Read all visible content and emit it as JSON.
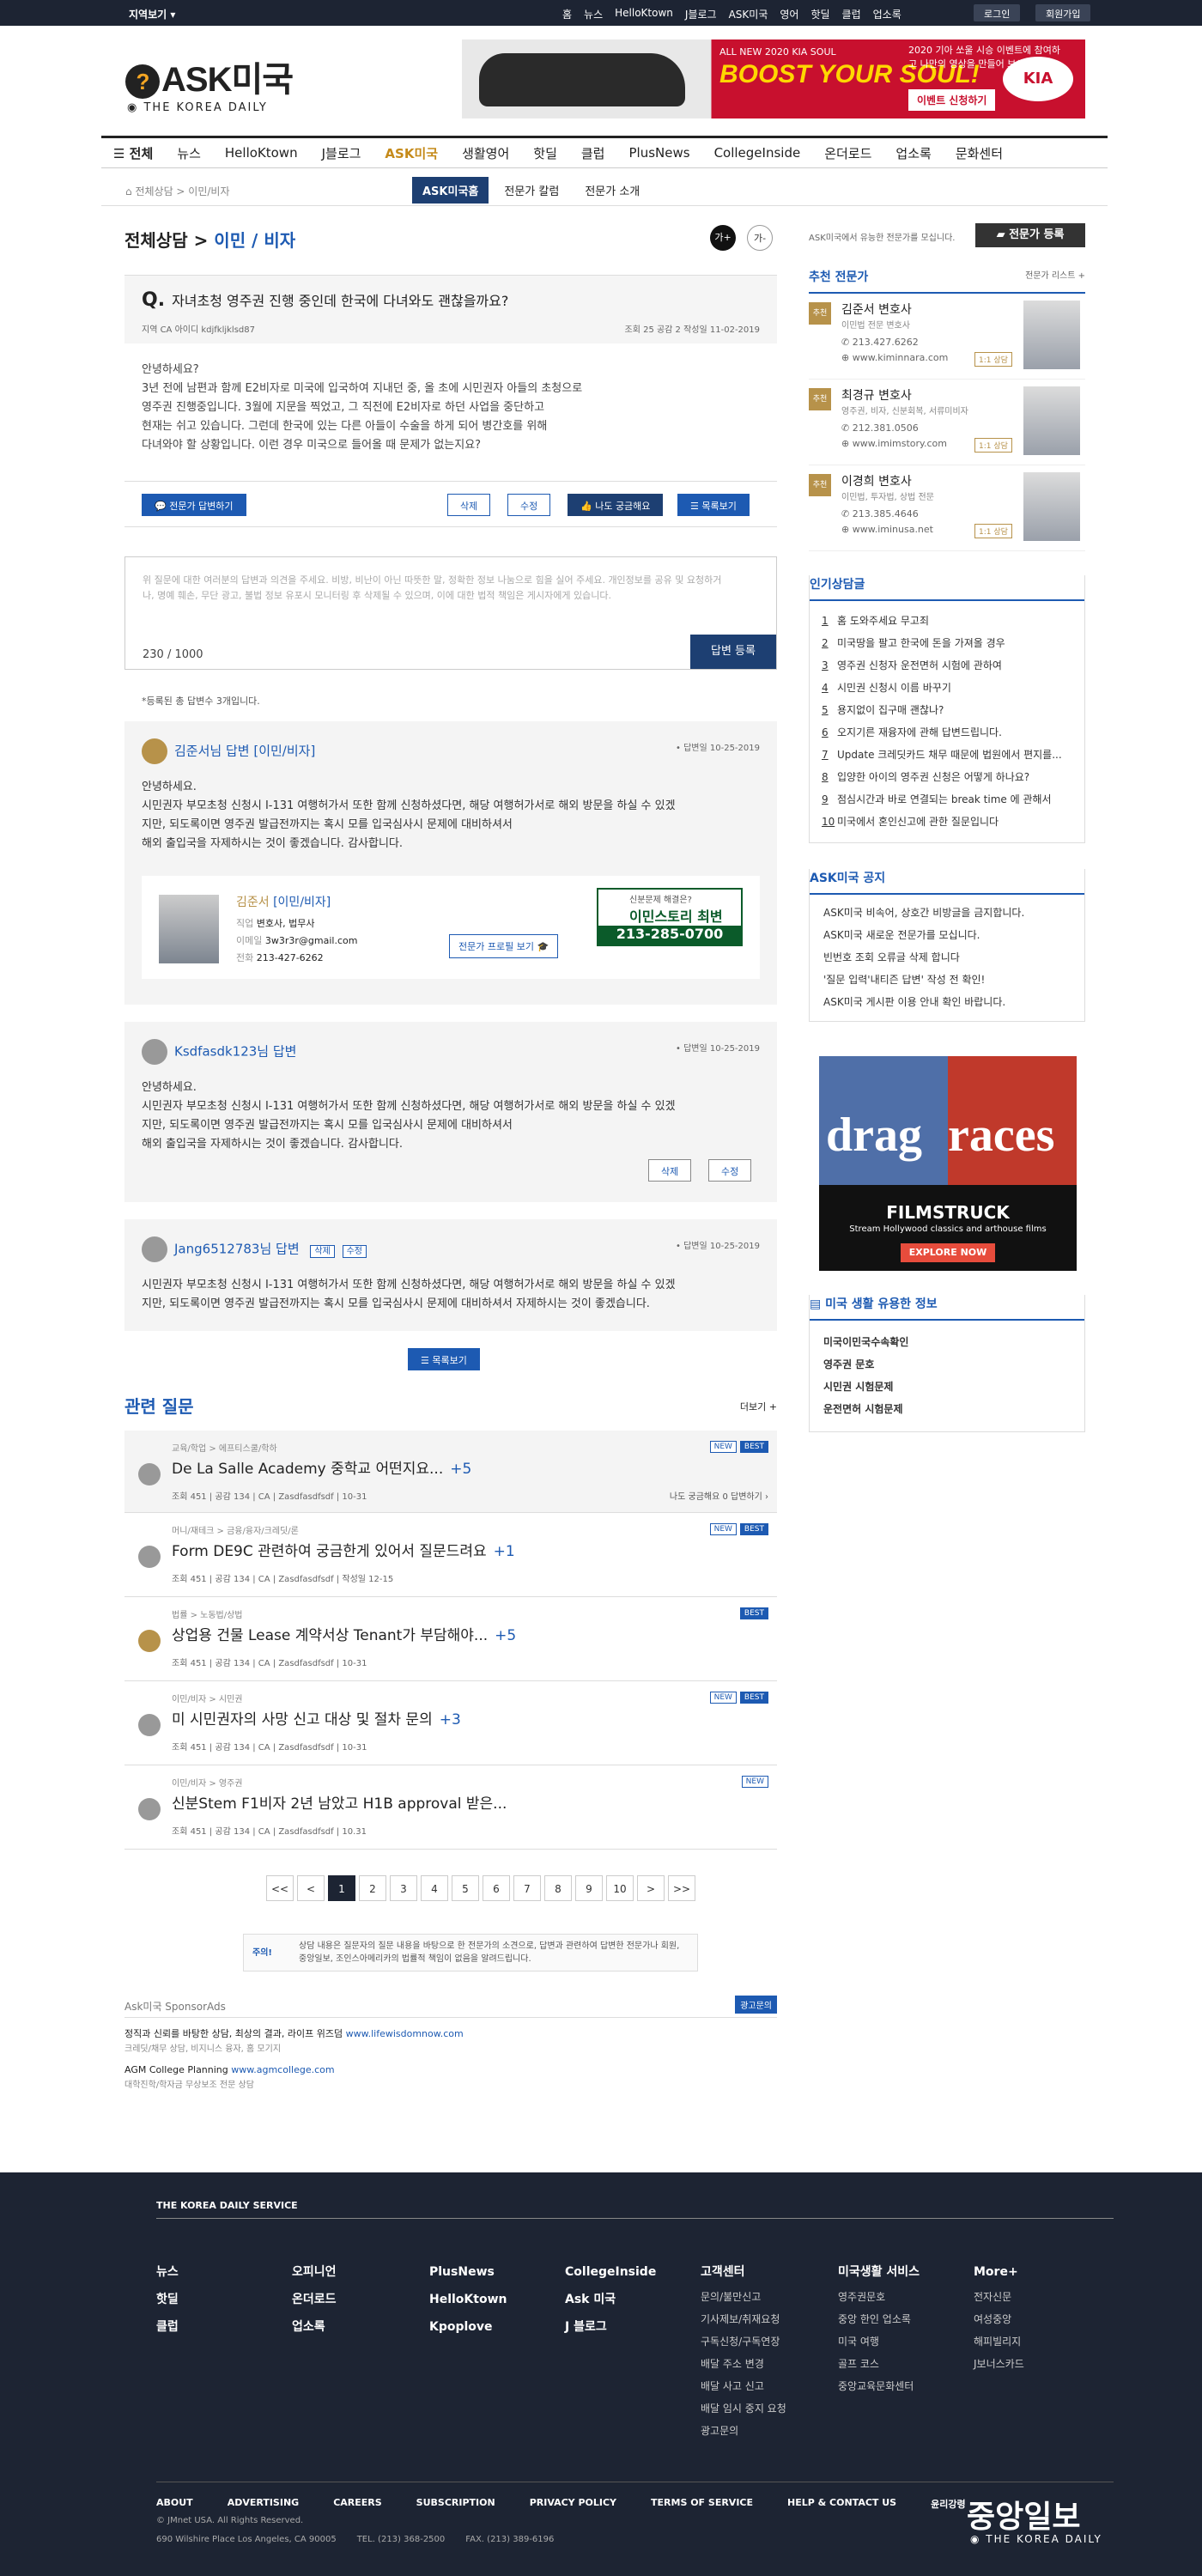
{
  "topbar": {
    "region": "지역보기",
    "links": [
      "홈",
      "뉴스",
      "HelloKtown",
      "J블로그",
      "ASK미국",
      "영어",
      "핫딜",
      "클럽",
      "업소록"
    ],
    "login": "로그인",
    "join": "회원가입"
  },
  "header": {
    "logo": "ASK미국",
    "logo_sub": "THE KOREA DAILY",
    "ad_line1": "ALL NEW 2020 KIA SOUL",
    "ad_main": "BOOST YOUR SOUL!",
    "ad_right": "2020 기아 쏘울 시승 이벤트에 참여하고 나만의 영상을 만들어 보세요!",
    "ad_cta": "이벤트 신청하기",
    "ad_brand": "KIA"
  },
  "nav": [
    "전체",
    "뉴스",
    "HelloKtown",
    "J블로그",
    "ASK미국",
    "생활영어",
    "핫딜",
    "클럽",
    "PlusNews",
    "CollegeInside",
    "온더로드",
    "업소록",
    "문화센터"
  ],
  "crumb": "전체상담  >  이민/비자",
  "tabs": [
    "ASK미국홈",
    "전문가 칼럼",
    "전문가 소개"
  ],
  "page": {
    "title": "전체상담",
    "title_sub": "이민 / 비자",
    "font_big": "가+",
    "font_small": "가-"
  },
  "question": {
    "q": "Q.",
    "title": "자녀초청 영주권 진행 중인데 한국에 다녀와도 괜찮을까요?",
    "meta": "지역 CA    아이디 kdjfkljklsd87",
    "meta2": "조회 25    공감 2    작성일 11-02-2019",
    "body": [
      "안녕하세요?",
      "3년 전에 남편과 함께 E2비자로 미국에 입국하여 지내던 중, 올 초에 시민권자 아들의 초청으로",
      "영주권 진행중입니다. 3월에 지문을 찍었고, 그 직전에 E2비자로 하던 사업을 중단하고",
      "현재는 쉬고 있습니다. 그런데 한국에 있는 다른 아들이 수술을 하게 되어 병간호를 위해",
      "다녀와야 할 상황입니다. 이런 경우 미국으로 들어올 때 문제가 없는지요?"
    ]
  },
  "buttons": {
    "expert_answer": "전문가 답변하기",
    "delete": "삭제",
    "edit": "수정",
    "curious": "나도 궁금해요",
    "list": "목록보기"
  },
  "comment": {
    "placeholder": "위 질문에 대한 여러분의 답변과 의견을 주세요. 비방, 비난이 아닌 따뜻한 말, 정확한 정보 나눔으로 힘을 실어 주세요. 개인정보를 공유 및 요청하거나, 명예 훼손, 무단 광고, 불법 정보 유포시 모니터링 후 삭제될 수 있으며, 이에 대한 법적 책임은 게시자에게 있습니다.",
    "count": "230 / 1000",
    "submit": "답변 등록"
  },
  "answer_count": "*등록된 총 답변수 3개입니다.",
  "answers": [
    {
      "name": "김준서님 답변",
      "cat": "[이민/비자]",
      "date": "• 답변일 10-25-2019",
      "body": [
        "안녕하세요.",
        "시민권자 부모초청 신청시 I-131 여행허가서 또한 함께 신청하셨다면, 해당 여행허가서로 해외 방문을 하실 수 있겠",
        "지만, 되도록이면 영주권 발급전까지는 혹시 모를 입국심사시 문제에 대비하셔서",
        "해외 출입국을 자제하시는 것이 좋겠습니다. 감사합니다."
      ]
    },
    {
      "name": "Ksdfasdk123님 답변",
      "date": "• 답변일 10-25-2019",
      "body": [
        "안녕하세요.",
        "시민권자 부모초청 신청시 I-131 여행허가서 또한 함께 신청하셨다면, 해당 여행허가서로 해외 방문을 하실 수 있겠",
        "지만, 되도록이면 영주권 발급전까지는 혹시 모를 입국심사시 문제에 대비하셔서",
        "해외 출입국을 자제하시는 것이 좋겠습니다. 감사합니다."
      ]
    },
    {
      "name": "Jang6512783님 답변",
      "date": "• 답변일 10-25-2019",
      "body": [
        "시민권자 부모초청 신청시 I-131 여행허가서 또한 함께 신청하셨다면, 해당 여행허가서로 해외 방문을 하실 수 있겠",
        "지만, 되도록이면 영주권 발급전까지는 혹시 모를 입국심사시 문제에 대비하셔서 자제하시는 것이 좋겠습니다."
      ]
    }
  ],
  "expert_card": {
    "name": "김준서",
    "cat": "[이민/비자]",
    "job_l": "직업",
    "job": "변호사, 법무사",
    "mail_l": "이메일",
    "mail": "3w3r3r@gmail.com",
    "tel_l": "전화",
    "tel": "213-427-6262",
    "profile": "전문가 프로필 보기",
    "ad_q": "신분문제 해결은?",
    "ad_name": "이민스토리 최변",
    "ad_tel": "213-285-0700"
  },
  "related": {
    "title": "관련 질문",
    "more": "더보기 +",
    "items": [
      {
        "cat": "교육/학업 > 에프티스쿨/학하",
        "title": "De La Salle Academy 중학교 어떤지요...",
        "plus": "+5",
        "meta": "조회 451  |  공감 134  |  CA  |  Zasdfasdfsdf  |  10-31",
        "badges": [
          "NEW",
          "BEST"
        ],
        "extra": "나도 궁금해요  0     답변하기 ›"
      },
      {
        "cat": "머니/재테크 > 금융/융자/크레딧/론",
        "title": "Form DE9C 관련하여 궁금한게 있어서 질문드려요",
        "plus": "+1",
        "meta": "조회 451  |  공감 134  |  CA  |  Zasdfasdfsdf  |  작성일 12-15",
        "badges": [
          "NEW",
          "BEST"
        ]
      },
      {
        "cat": "법률 > 노동법/상법",
        "title": "상업용 건물 Lease 계약서상 Tenant가 부담해야...",
        "plus": "+5",
        "meta": "조회 451  |  공감 134  |  CA  |  Zasdfasdfsdf  |  10-31",
        "badges": [
          "BEST"
        ]
      },
      {
        "cat": "이민/비자 > 시민권",
        "title": "미 시민권자의 사망 신고 대상 및 절차 문의",
        "plus": "+3",
        "meta": "조회 451  |  공감 134  |  CA  |  Zasdfasdfsdf  |  10-31",
        "badges": [
          "NEW",
          "BEST"
        ]
      },
      {
        "cat": "이민/비자 > 영주권",
        "title": "신분Stem F1비자 2년 남았고 H1B approval 받은...",
        "plus": "",
        "meta": "조회 451  |  공감 134  |  CA  |  Zasdfasdfsdf  |  10.31",
        "badges": [
          "NEW"
        ]
      }
    ]
  },
  "pager": [
    "<<",
    "<",
    "1",
    "2",
    "3",
    "4",
    "5",
    "6",
    "7",
    "8",
    "9",
    "10",
    ">",
    ">>"
  ],
  "notice": {
    "label": "주의!",
    "text": "상담 내용은 질문자의 질문 내용을 바탕으로 한 전문가의 소견으로, 답변과 관련하여 답변한 전문가나 회원, 중앙일보, 조인스아메리카의 법률적 책임이 없음을 알려드립니다."
  },
  "sponsor": {
    "title": "Ask미국 SponsorAds",
    "apply": "광고문의",
    "items": [
      {
        "t": "정직과 신뢰를 바탕한 상담, 최상의 결과, 라이프 위즈덤",
        "u": "www.lifewisdomnow.com",
        "s": "크레딧/채무 상담, 비지니스 융자, 홈 모기지"
      },
      {
        "t": "AGM College Planning",
        "u": "www.agmcollege.com",
        "s": "대학진학/학자금 무상보조 전문 상담"
      }
    ]
  },
  "sidebar": {
    "promo": "ASK미국에서 유능한 전문가를 모십니다.",
    "register": "전문가 등록",
    "rec_title": "추천 전문가",
    "rec_list": "전문가 리스트 +",
    "experts": [
      {
        "tag": "추천",
        "name": "김준서 변호사",
        "desc": "이민법 전문 변호사",
        "phone": "213.427.6262",
        "web": "www.kiminnara.com",
        "con": "1:1 상담"
      },
      {
        "tag": "추천",
        "name": "최경규 변호사",
        "desc": "영주권, 비자, 신분회복, 서류미비자",
        "phone": "212.381.0506",
        "web": "www.imimstory.com",
        "con": "1:1 상담"
      },
      {
        "tag": "추천",
        "name": "이경희 변호사",
        "desc": "이민법, 투자법, 상법 전문",
        "phone": "213.385.4646",
        "web": "www.iminusa.net",
        "con": "1:1 상담"
      }
    ],
    "pop_title": "인기상담글",
    "pop": [
      "홈 도와주세요 무고죄",
      "미국땅을 팔고 한국에 돈을 가져올 경우",
      "영주권 신청자 운전면허 시험에 관하여",
      "시민권 신청시 이름 바꾸기",
      "용지없이 집구매 괜찮나?",
      "오지기른 재융자에 관해 답변드립니다.",
      "Update 크레딧카드 채무 때문에 법원에서 편지를...",
      "입양한 아이의 영주권 신청은 어떻게 하나요?",
      "점심시간과 바로 연결되는 break time 에 관해서",
      "미국에서 혼인신고에 관한 질문입니다"
    ],
    "notice_title": "ASK미국 공지",
    "notices": [
      "ASK미국 비속어, 상호간 비방글을 금지합니다.",
      "ASK미국 새로운 전문가를 모십니다.",
      "빈번호 조회 오류글 삭제 합니다",
      "'질문 입력'내티즌 답변' 작성 전 확인!",
      "ASK미국 게시판 이용 안내 확인 바랍니다."
    ],
    "ad": {
      "l1": "drag",
      "l2": "races",
      "brand": "FILMSTRUCK",
      "sub": "Stream Hollywood classics and arthouse films",
      "cta": "EXPLORE NOW"
    },
    "info_title": "미국 생활 유용한 정보",
    "info": [
      "미국이민국수속확인",
      "영주권 문호",
      "시민권 시험문제",
      "운전면허 시험문제"
    ]
  },
  "footer": {
    "brand": "THE KOREA DAILY SERVICE",
    "col1": [
      "뉴스",
      "핫딜",
      "클럽"
    ],
    "col2": [
      "오피니언",
      "온더로드",
      "업소록"
    ],
    "col3": [
      "PlusNews",
      "HelloKtown",
      "Kpoplove"
    ],
    "col4": [
      "CollegeInside",
      "Ask 미국",
      "J 블로그"
    ],
    "col5h": "고객센터",
    "col5": [
      "문의/불만신고",
      "기사제보/취재요청",
      "구독신청/구독연장",
      "배달 주소 변경",
      "배달 사고 신고",
      "배달 임시 중지 요청",
      "광고문의"
    ],
    "col6h": "미국생활 서비스",
    "col6": [
      "영주권문호",
      "중앙 한인 업소록",
      "미국 여행",
      "골프 코스",
      "중앙교육문화센터"
    ],
    "col7h": "More+",
    "col7": [
      "전자신문",
      "여성중앙",
      "해피빌리지",
      "J보너스카드"
    ],
    "links": [
      "ABOUT",
      "ADVERTISING",
      "CAREERS",
      "SUBSCRIPTION",
      "PRIVACY POLICY",
      "TERMS OF SERVICE",
      "HELP & CONTACT US",
      "윤리강령"
    ],
    "copy": "© JMnet USA. All Rights Reserved.",
    "addr": "690 Wilshire Place Los Angeles, CA 90005",
    "tel": "TEL. (213) 368-2500",
    "fax": "FAX. (213) 389-6196",
    "logo": "중앙일보",
    "logo_sub": "THE KOREA DAILY"
  }
}
